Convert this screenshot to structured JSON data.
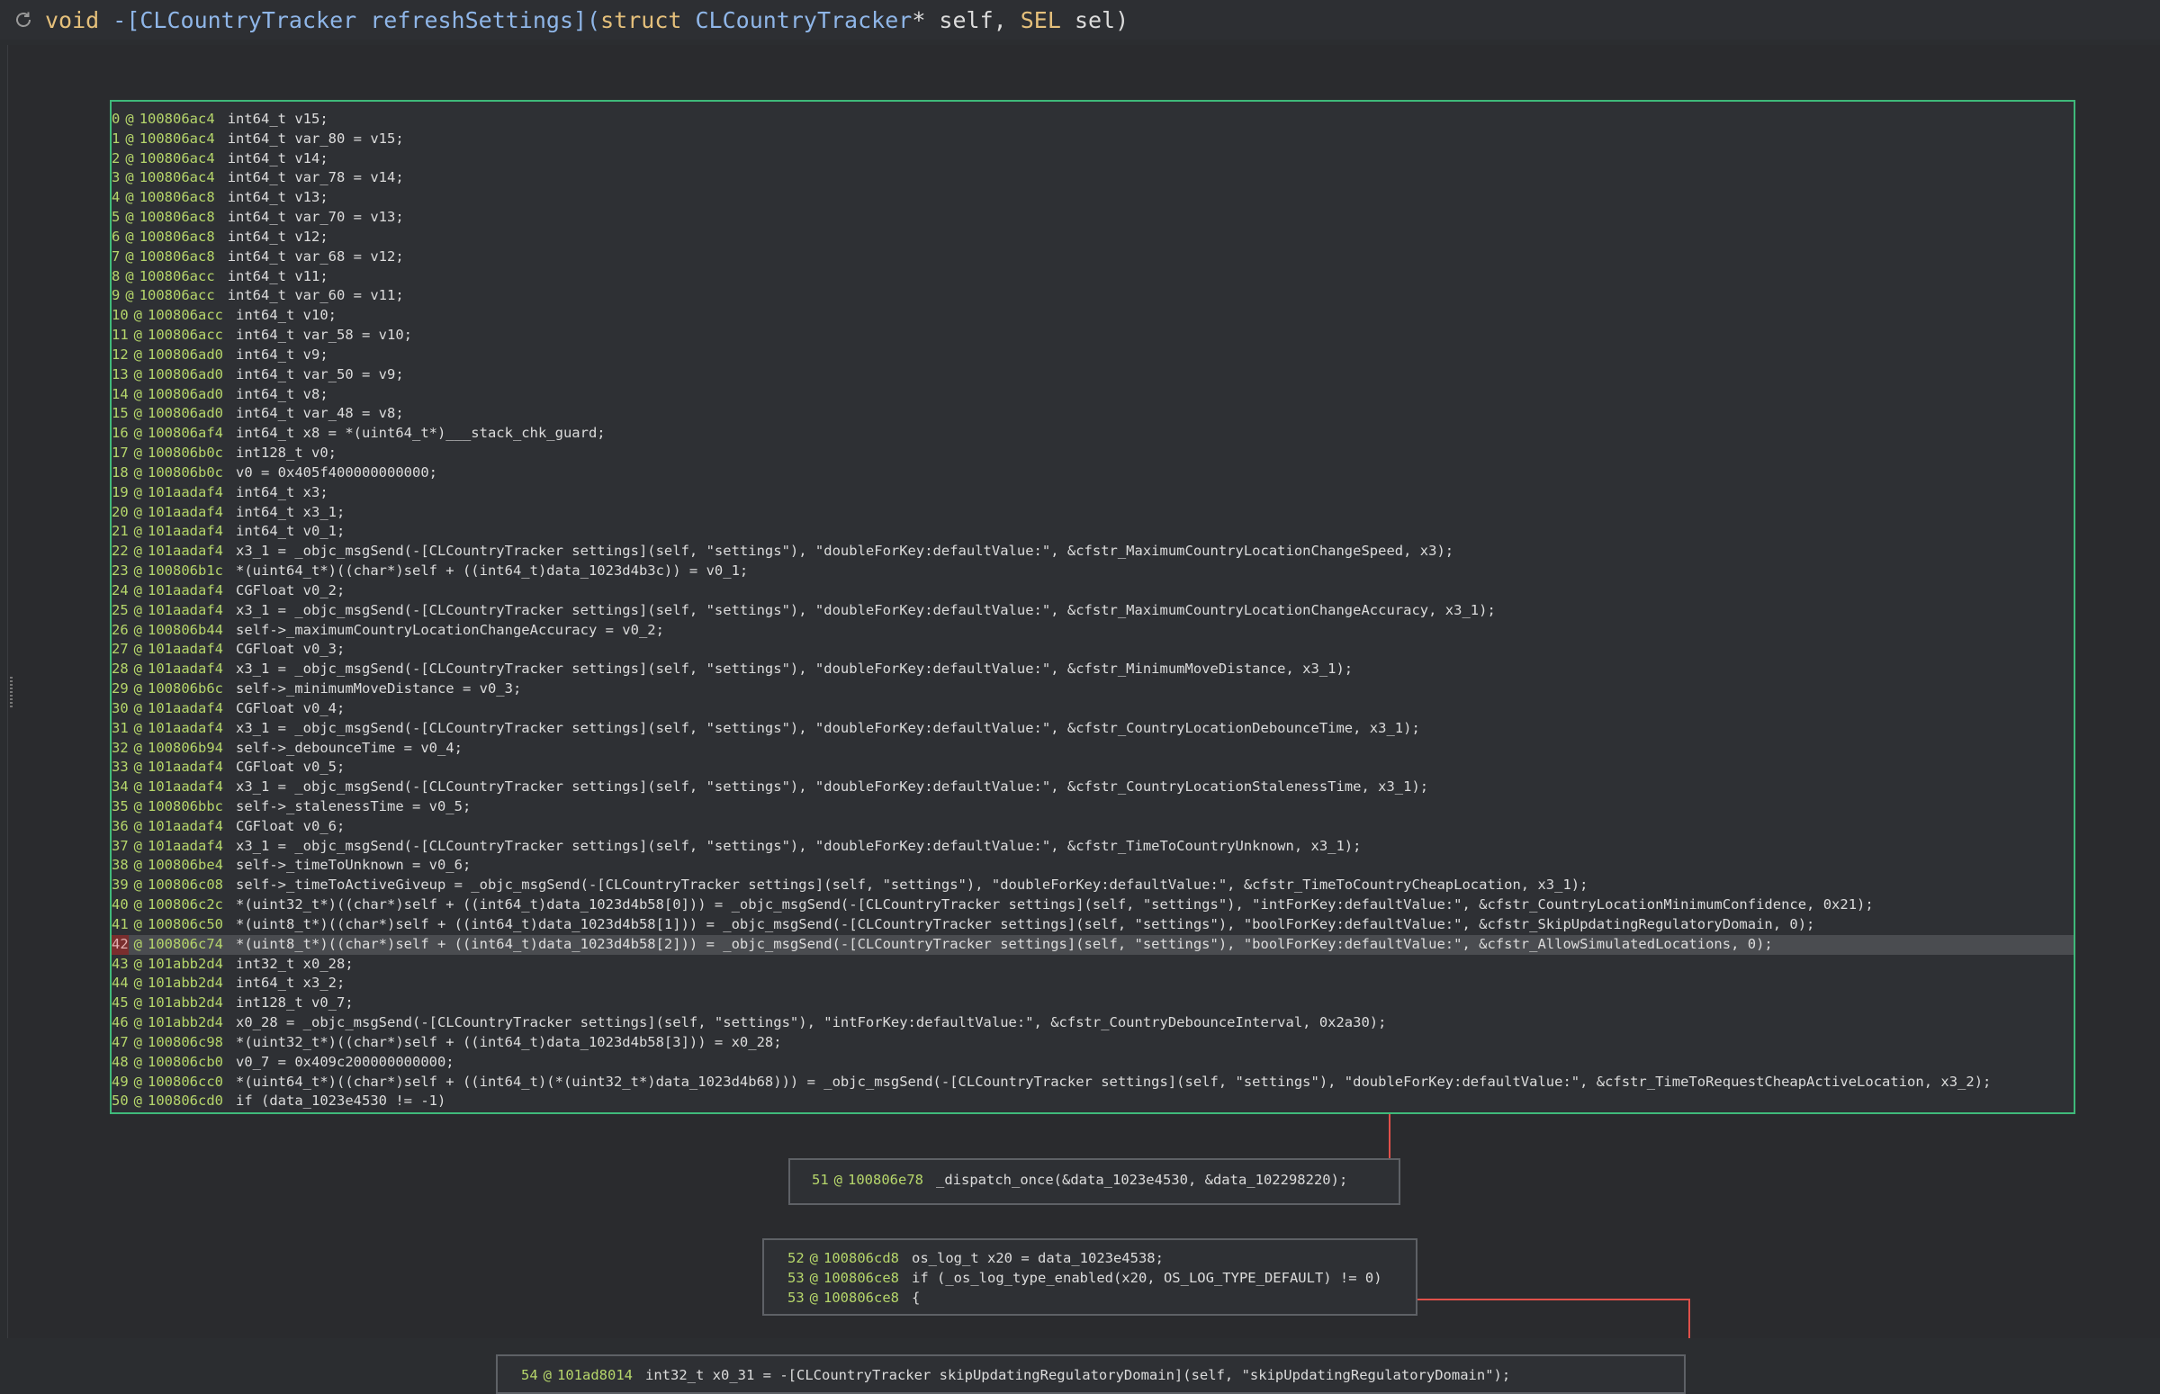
{
  "header": {
    "signature_parts": [
      {
        "text": "void ",
        "cls": "kw"
      },
      {
        "text": "-[CLCountryTracker refreshSettings](",
        "cls": "fn"
      },
      {
        "text": "struct ",
        "cls": "kw"
      },
      {
        "text": "CLCountryTracker",
        "cls": "fn"
      },
      {
        "text": "* self, ",
        "cls": "plain"
      },
      {
        "text": "SEL",
        "cls": "kw"
      },
      {
        "text": " sel)",
        "cls": "plain"
      }
    ]
  },
  "colors": {
    "background": "#2b2d30",
    "block_border": "#5e6166",
    "entry_block_border": "#3fb97a",
    "line_numbers": "#b6d66b",
    "highlight_row": "#4a4c50",
    "breakpoint_marker": "#7a2e2e",
    "edge_true": "#3fb97a",
    "edge_false": "#e0504a",
    "edge_default": "#7aa6e0"
  },
  "main_block": {
    "highlighted_line": "42",
    "lines": [
      {
        "n": "0",
        "addr": "100806ac4",
        "code": "int64_t v15;"
      },
      {
        "n": "1",
        "addr": "100806ac4",
        "code": "int64_t var_80 = v15;"
      },
      {
        "n": "2",
        "addr": "100806ac4",
        "code": "int64_t v14;"
      },
      {
        "n": "3",
        "addr": "100806ac4",
        "code": "int64_t var_78 = v14;"
      },
      {
        "n": "4",
        "addr": "100806ac8",
        "code": "int64_t v13;"
      },
      {
        "n": "5",
        "addr": "100806ac8",
        "code": "int64_t var_70 = v13;"
      },
      {
        "n": "6",
        "addr": "100806ac8",
        "code": "int64_t v12;"
      },
      {
        "n": "7",
        "addr": "100806ac8",
        "code": "int64_t var_68 = v12;"
      },
      {
        "n": "8",
        "addr": "100806acc",
        "code": "int64_t v11;"
      },
      {
        "n": "9",
        "addr": "100806acc",
        "code": "int64_t var_60 = v11;"
      },
      {
        "n": "10",
        "addr": "100806acc",
        "code": "int64_t v10;"
      },
      {
        "n": "11",
        "addr": "100806acc",
        "code": "int64_t var_58 = v10;"
      },
      {
        "n": "12",
        "addr": "100806ad0",
        "code": "int64_t v9;"
      },
      {
        "n": "13",
        "addr": "100806ad0",
        "code": "int64_t var_50 = v9;"
      },
      {
        "n": "14",
        "addr": "100806ad0",
        "code": "int64_t v8;"
      },
      {
        "n": "15",
        "addr": "100806ad0",
        "code": "int64_t var_48 = v8;"
      },
      {
        "n": "16",
        "addr": "100806af4",
        "code": "int64_t x8 = *(uint64_t*)___stack_chk_guard;"
      },
      {
        "n": "17",
        "addr": "100806b0c",
        "code": "int128_t v0;"
      },
      {
        "n": "18",
        "addr": "100806b0c",
        "code": "v0 = 0x405f400000000000;"
      },
      {
        "n": "19",
        "addr": "101aadaf4",
        "code": "int64_t x3;"
      },
      {
        "n": "20",
        "addr": "101aadaf4",
        "code": "int64_t x3_1;"
      },
      {
        "n": "21",
        "addr": "101aadaf4",
        "code": "int64_t v0_1;"
      },
      {
        "n": "22",
        "addr": "101aadaf4",
        "code": "x3_1 = _objc_msgSend(-[CLCountryTracker settings](self, \"settings\"), \"doubleForKey:defaultValue:\", &cfstr_MaximumCountryLocationChangeSpeed, x3);"
      },
      {
        "n": "23",
        "addr": "100806b1c",
        "code": "*(uint64_t*)((char*)self + ((int64_t)data_1023d4b3c)) = v0_1;"
      },
      {
        "n": "24",
        "addr": "101aadaf4",
        "code": "CGFloat v0_2;"
      },
      {
        "n": "25",
        "addr": "101aadaf4",
        "code": "x3_1 = _objc_msgSend(-[CLCountryTracker settings](self, \"settings\"), \"doubleForKey:defaultValue:\", &cfstr_MaximumCountryLocationChangeAccuracy, x3_1);"
      },
      {
        "n": "26",
        "addr": "100806b44",
        "code": "self->_maximumCountryLocationChangeAccuracy = v0_2;"
      },
      {
        "n": "27",
        "addr": "101aadaf4",
        "code": "CGFloat v0_3;"
      },
      {
        "n": "28",
        "addr": "101aadaf4",
        "code": "x3_1 = _objc_msgSend(-[CLCountryTracker settings](self, \"settings\"), \"doubleForKey:defaultValue:\", &cfstr_MinimumMoveDistance, x3_1);"
      },
      {
        "n": "29",
        "addr": "100806b6c",
        "code": "self->_minimumMoveDistance = v0_3;"
      },
      {
        "n": "30",
        "addr": "101aadaf4",
        "code": "CGFloat v0_4;"
      },
      {
        "n": "31",
        "addr": "101aadaf4",
        "code": "x3_1 = _objc_msgSend(-[CLCountryTracker settings](self, \"settings\"), \"doubleForKey:defaultValue:\", &cfstr_CountryLocationDebounceTime, x3_1);"
      },
      {
        "n": "32",
        "addr": "100806b94",
        "code": "self->_debounceTime = v0_4;"
      },
      {
        "n": "33",
        "addr": "101aadaf4",
        "code": "CGFloat v0_5;"
      },
      {
        "n": "34",
        "addr": "101aadaf4",
        "code": "x3_1 = _objc_msgSend(-[CLCountryTracker settings](self, \"settings\"), \"doubleForKey:defaultValue:\", &cfstr_CountryLocationStalenessTime, x3_1);"
      },
      {
        "n": "35",
        "addr": "100806bbc",
        "code": "self->_stalenessTime = v0_5;"
      },
      {
        "n": "36",
        "addr": "101aadaf4",
        "code": "CGFloat v0_6;"
      },
      {
        "n": "37",
        "addr": "101aadaf4",
        "code": "x3_1 = _objc_msgSend(-[CLCountryTracker settings](self, \"settings\"), \"doubleForKey:defaultValue:\", &cfstr_TimeToCountryUnknown, x3_1);"
      },
      {
        "n": "38",
        "addr": "100806be4",
        "code": "self->_timeToUnknown = v0_6;"
      },
      {
        "n": "39",
        "addr": "100806c08",
        "code": "self->_timeToActiveGiveup = _objc_msgSend(-[CLCountryTracker settings](self, \"settings\"), \"doubleForKey:defaultValue:\", &cfstr_TimeToCountryCheapLocation, x3_1);"
      },
      {
        "n": "40",
        "addr": "100806c2c",
        "code": "*(uint32_t*)((char*)self + ((int64_t)data_1023d4b58[0])) = _objc_msgSend(-[CLCountryTracker settings](self, \"settings\"), \"intForKey:defaultValue:\", &cfstr_CountryLocationMinimumConfidence, 0x21);"
      },
      {
        "n": "41",
        "addr": "100806c50",
        "code": "*(uint8_t*)((char*)self + ((int64_t)data_1023d4b58[1])) = _objc_msgSend(-[CLCountryTracker settings](self, \"settings\"), \"boolForKey:defaultValue:\", &cfstr_SkipUpdatingRegulatoryDomain, 0);"
      },
      {
        "n": "42",
        "addr": "100806c74",
        "code": "*(uint8_t*)((char*)self + ((int64_t)data_1023d4b58[2])) = _objc_msgSend(-[CLCountryTracker settings](self, \"settings\"), \"boolForKey:defaultValue:\", &cfstr_AllowSimulatedLocations, 0);"
      },
      {
        "n": "43",
        "addr": "101abb2d4",
        "code": "int32_t x0_28;"
      },
      {
        "n": "44",
        "addr": "101abb2d4",
        "code": "int64_t x3_2;"
      },
      {
        "n": "45",
        "addr": "101abb2d4",
        "code": "int128_t v0_7;"
      },
      {
        "n": "46",
        "addr": "101abb2d4",
        "code": "x0_28 = _objc_msgSend(-[CLCountryTracker settings](self, \"settings\"), \"intForKey:defaultValue:\", &cfstr_CountryDebounceInterval, 0x2a30);"
      },
      {
        "n": "47",
        "addr": "100806c98",
        "code": "*(uint32_t*)((char*)self + ((int64_t)data_1023d4b58[3])) = x0_28;"
      },
      {
        "n": "48",
        "addr": "100806cb0",
        "code": "v0_7 = 0x409c200000000000;"
      },
      {
        "n": "49",
        "addr": "100806cc0",
        "code": "*(uint64_t*)((char*)self + ((int64_t)(*(uint32_t*)data_1023d4b68))) = _objc_msgSend(-[CLCountryTracker settings](self, \"settings\"), \"doubleForKey:defaultValue:\", &cfstr_TimeToRequestCheapActiveLocation, x3_2);"
      },
      {
        "n": "50",
        "addr": "100806cd0",
        "code": "if (data_1023e4530 != -1)"
      }
    ]
  },
  "block_51": {
    "lines": [
      {
        "n": "51",
        "addr": "100806e78",
        "code": "_dispatch_once(&data_1023e4530, &data_102298220);"
      }
    ]
  },
  "block_52": {
    "lines": [
      {
        "n": "52",
        "addr": "100806cd8",
        "code": "os_log_t x20 = data_1023e4538;"
      },
      {
        "n": "53",
        "addr": "100806ce8",
        "code": "if (_os_log_type_enabled(x20, OS_LOG_TYPE_DEFAULT) != 0)"
      },
      {
        "n": "53",
        "addr": "100806ce8",
        "code": "{"
      }
    ]
  },
  "block_54": {
    "lines": [
      {
        "n": "54",
        "addr": "101ad8014",
        "code": "int32_t x0_31 = -[CLCountryTracker skipUpdatingRegulatoryDomain](self, \"skipUpdatingRegulatoryDomain\");"
      }
    ]
  }
}
